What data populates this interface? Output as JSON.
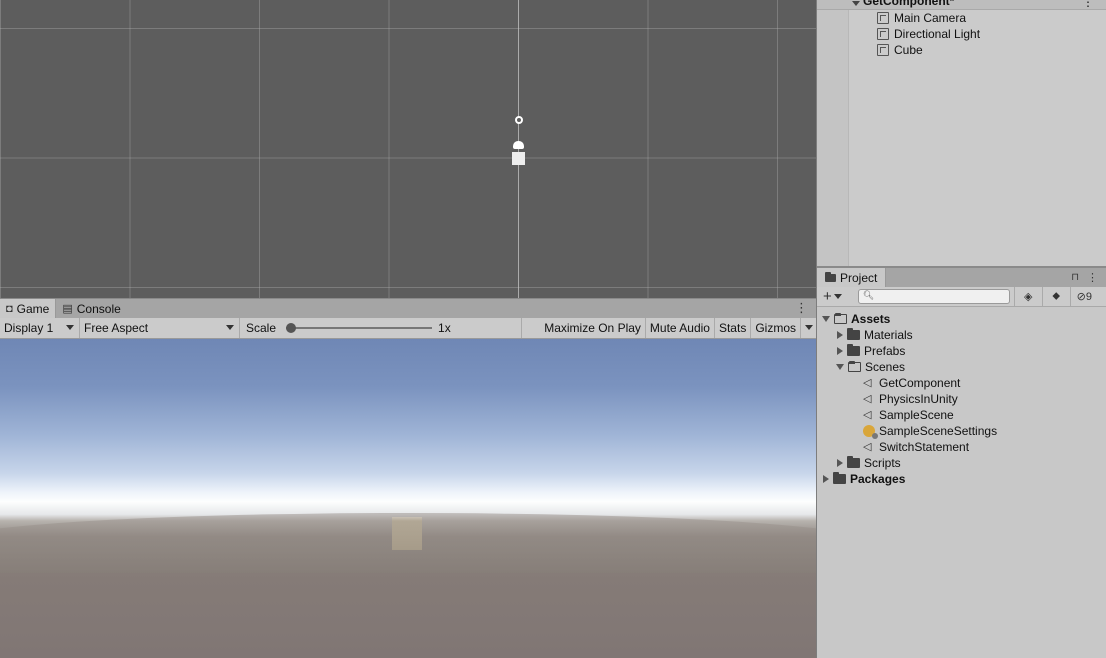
{
  "scene_view": {},
  "game_panel": {
    "tabs": [
      {
        "label": "Game",
        "icon": "gamepad-icon"
      },
      {
        "label": "Console",
        "icon": "console-icon"
      }
    ],
    "kebab": "⋮",
    "toolbar": {
      "display": "Display 1",
      "aspect": "Free Aspect",
      "scale_label": "Scale",
      "scale_value": "1x",
      "scale_fraction": 0,
      "maximize": "Maximize On Play",
      "mute": "Mute Audio",
      "stats": "Stats",
      "gizmos": "Gizmos"
    }
  },
  "hierarchy": {
    "scene_name": "GetComponent*",
    "kebab": "⋮",
    "items": [
      {
        "label": "Main Camera",
        "icon": "cube-icon"
      },
      {
        "label": "Directional Light",
        "icon": "cube-icon"
      },
      {
        "label": "Cube",
        "icon": "cube-icon"
      }
    ]
  },
  "project": {
    "tab_label": "Project",
    "lock": "🔒",
    "kebab": "⋮",
    "add_label": "+",
    "search_placeholder": "",
    "hidden_count": "9",
    "tree": {
      "assets": "Assets",
      "materials": "Materials",
      "prefabs": "Prefabs",
      "scenes": "Scenes",
      "scene_files": [
        "GetComponent",
        "PhysicsInUnity",
        "SampleScene",
        "SampleSceneSettings",
        "SwitchStatement"
      ],
      "scripts": "Scripts",
      "packages": "Packages"
    }
  },
  "colors": {
    "scene_bg": "#5d5d5d",
    "panel_bg": "#c8c8c8",
    "tab_bar": "#a5a5a5"
  }
}
